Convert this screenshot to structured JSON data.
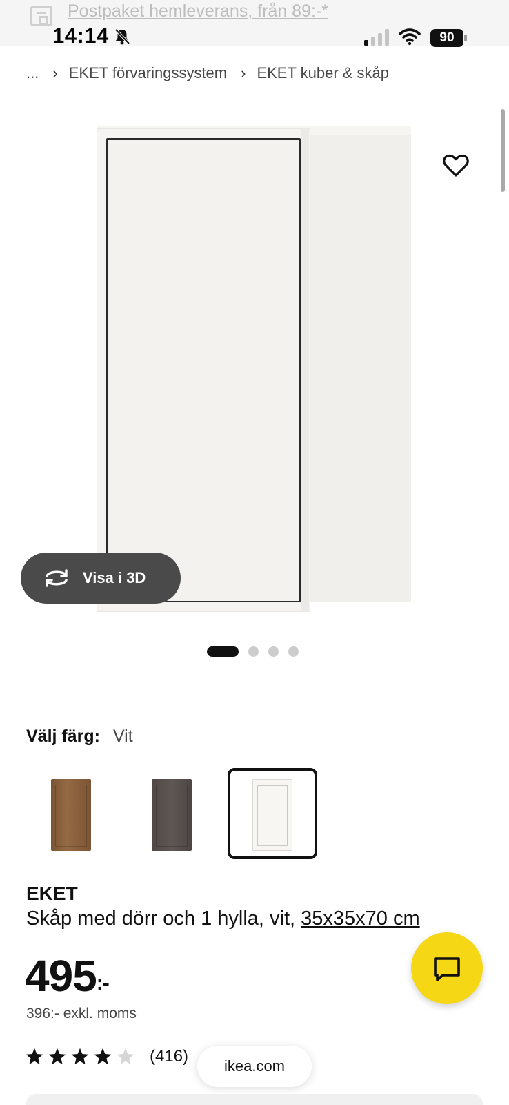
{
  "promo": {
    "text": "Postpaket hemleverans, från 89:-*",
    "icon": "package-icon"
  },
  "status_bar": {
    "time": "14:14",
    "battery": "90",
    "icons": [
      "bell-slash-icon",
      "signal-icon",
      "wifi-icon",
      "battery-icon"
    ]
  },
  "breadcrumb": {
    "ellipsis": "...",
    "items": [
      {
        "label": "EKET förvaringssystem"
      },
      {
        "label": "EKET kuber & skåp"
      }
    ]
  },
  "gallery": {
    "favorite_icon": "heart-icon",
    "view_3d_label": "Visa i 3D",
    "view_3d_icon": "rotate-icon",
    "image_count": 4,
    "active_image": 1
  },
  "color_picker": {
    "label": "Välj färg:",
    "selected_value": "Vit",
    "options": [
      {
        "name": "walnut-effect",
        "color": "#8a6240"
      },
      {
        "name": "dark-grey",
        "color": "#57504d"
      },
      {
        "name": "white",
        "color": "#f7f6f3",
        "selected": true
      }
    ]
  },
  "product": {
    "name": "EKET",
    "description": "Skåp med dörr och 1 hylla, vit, ",
    "size": "35x35x70 cm",
    "price": "495",
    "price_suffix": ":-",
    "price_ex_vat": "396:- exkl. moms",
    "rating": 4,
    "rating_max": 5,
    "rating_count": "(416)"
  },
  "chat": {
    "icon": "chat-icon"
  },
  "browser": {
    "url": "ikea.com"
  },
  "colors": {
    "accent_yellow": "#f6d716",
    "text_primary": "#111111",
    "text_secondary": "#484848",
    "pill_dark": "#4a4a4a"
  }
}
